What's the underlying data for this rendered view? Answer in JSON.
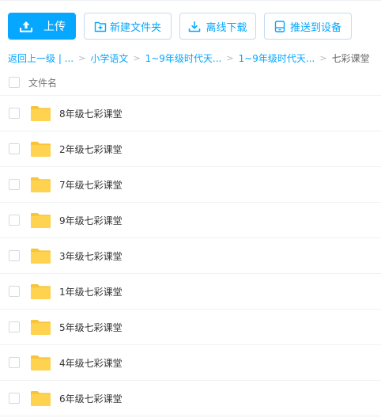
{
  "toolbar": {
    "upload_label": "上传",
    "new_folder_label": "新建文件夹",
    "offline_download_label": "离线下载",
    "push_to_device_label": "推送到设备"
  },
  "breadcrumb": {
    "back_label": "返回上一级 | ...",
    "items": [
      "小学语文",
      "1~9年级时代天...",
      "1~9年级时代天..."
    ],
    "current": "七彩课堂"
  },
  "list": {
    "header_label": "文件名",
    "items": [
      {
        "name": "8年级七彩课堂"
      },
      {
        "name": "2年级七彩课堂"
      },
      {
        "name": "7年级七彩课堂"
      },
      {
        "name": "9年级七彩课堂"
      },
      {
        "name": "3年级七彩课堂"
      },
      {
        "name": "1年级七彩课堂"
      },
      {
        "name": "5年级七彩课堂"
      },
      {
        "name": "4年级七彩课堂"
      },
      {
        "name": "6年级七彩课堂"
      }
    ]
  },
  "colors": {
    "accent": "#06a7ff",
    "folder": "#ffd34f",
    "folder_tab": "#f7c43a"
  },
  "icons": {
    "upload": "upload-icon",
    "new_folder": "new-folder-icon",
    "offline_download": "download-icon",
    "push": "device-icon",
    "folder": "folder-icon"
  }
}
